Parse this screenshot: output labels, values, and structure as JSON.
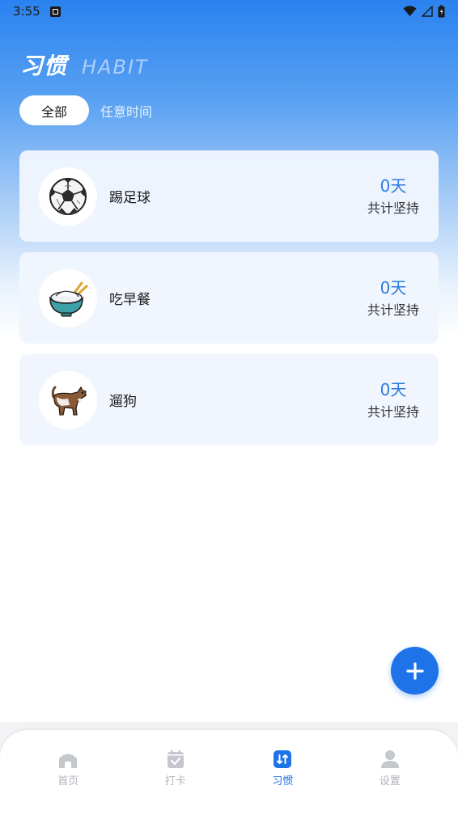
{
  "status_bar": {
    "time": "3:55"
  },
  "header": {
    "title_cn": "习惯",
    "title_en": "HABIT"
  },
  "filters": {
    "active": "全部",
    "other": "任意时间"
  },
  "habits": [
    {
      "name": "踢足球",
      "days": "0天",
      "label": "共计坚持",
      "icon": "soccer-ball-icon"
    },
    {
      "name": "吃早餐",
      "days": "0天",
      "label": "共计坚持",
      "icon": "rice-bowl-icon"
    },
    {
      "name": "遛狗",
      "days": "0天",
      "label": "共计坚持",
      "icon": "dog-icon"
    }
  ],
  "fab": {
    "icon": "plus-icon"
  },
  "tabs": [
    {
      "label": "首页",
      "icon": "home-icon"
    },
    {
      "label": "打卡",
      "icon": "calendar-check-icon"
    },
    {
      "label": "习惯",
      "icon": "habit-icon",
      "active": true
    },
    {
      "label": "设置",
      "icon": "user-icon"
    }
  ],
  "colors": {
    "accent": "#1e73e8",
    "days_text": "#2a7be0",
    "inactive_tab": "#b0b3ba"
  }
}
